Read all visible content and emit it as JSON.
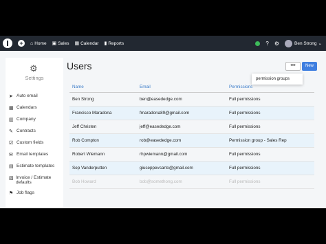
{
  "topbar": {
    "nav": [
      {
        "label": "Home",
        "icon": "home-icon"
      },
      {
        "label": "Sales",
        "icon": "sales-icon"
      },
      {
        "label": "Calendar",
        "icon": "calendar-icon"
      },
      {
        "label": "Reports",
        "icon": "reports-icon"
      }
    ],
    "user_name": "Ben Strong",
    "status_color": "#3dbb5a"
  },
  "sidebar": {
    "title": "Settings",
    "items": [
      {
        "label": "Auto email",
        "icon": "send-icon"
      },
      {
        "label": "Calendars",
        "icon": "calendar-icon"
      },
      {
        "label": "Company",
        "icon": "building-icon"
      },
      {
        "label": "Contracts",
        "icon": "pen-icon"
      },
      {
        "label": "Custom fields",
        "icon": "check-square-icon"
      },
      {
        "label": "Email templates",
        "icon": "envelope-icon"
      },
      {
        "label": "Estimate templates",
        "icon": "calculator-icon"
      },
      {
        "label": "Invoice / Estimate defaults",
        "icon": "invoice-icon"
      },
      {
        "label": "Job flags",
        "icon": "flag-icon"
      }
    ]
  },
  "main": {
    "title": "Users",
    "more_label": "•••",
    "new_label": "New",
    "dropdown_item": "permission groups",
    "columns": [
      "Name",
      "Email",
      "Permissions"
    ],
    "rows": [
      [
        "Ben Strong",
        "ben@easededge.com",
        "Full permissions"
      ],
      [
        "Francisco Maradona",
        "fmaradona89@gmail.com",
        "Full permissions"
      ],
      [
        "Jeff Christen",
        "jeff@easededge.com",
        "Full permissions"
      ],
      [
        "Rob Compton",
        "rob@easededge.com",
        "Permission group - Sales Rep"
      ],
      [
        "Robert Wiemann",
        "rhpwiemann@gmail.com",
        "Full permissions"
      ],
      [
        "Sep Vanderputten",
        "giuseppevsarto@gmail.com",
        "Full permissions"
      ],
      [
        "Bob Howard",
        "bob@somethong.com",
        "Full permissions"
      ]
    ]
  }
}
